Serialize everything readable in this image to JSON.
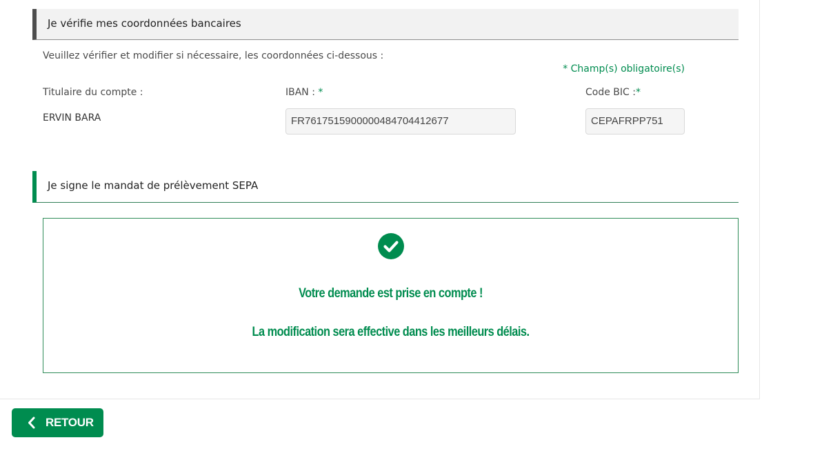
{
  "bank_section": {
    "title": "Je vérifie mes coordonnées bancaires",
    "intro": "Veuillez vérifier et modifier si nécessaire, les coordonnées ci-dessous :",
    "mandatory_note": "* Champ(s) obligatoire(s)",
    "holder_label": "Titulaire du compte :",
    "holder_value": "ERVIN BARA",
    "iban_label": "IBAN :",
    "iban_star": "*",
    "iban_value": "FR7617515900000484704412677",
    "bic_label": "Code BIC :",
    "bic_star": "*",
    "bic_value": "CEPAFRPP751"
  },
  "sepa_section": {
    "title": "Je signe le mandat de prélèvement SEPA",
    "confirm_icon": "check-circle-icon",
    "message_1": "Votre demande est prise en compte !",
    "message_2": "La modification sera effective dans les meilleurs délais."
  },
  "footer": {
    "back_label": "RETOUR",
    "back_icon": "chevron-left-icon"
  },
  "colors": {
    "brand_green": "#008c4f",
    "header_dark": "#4d4d4d"
  }
}
